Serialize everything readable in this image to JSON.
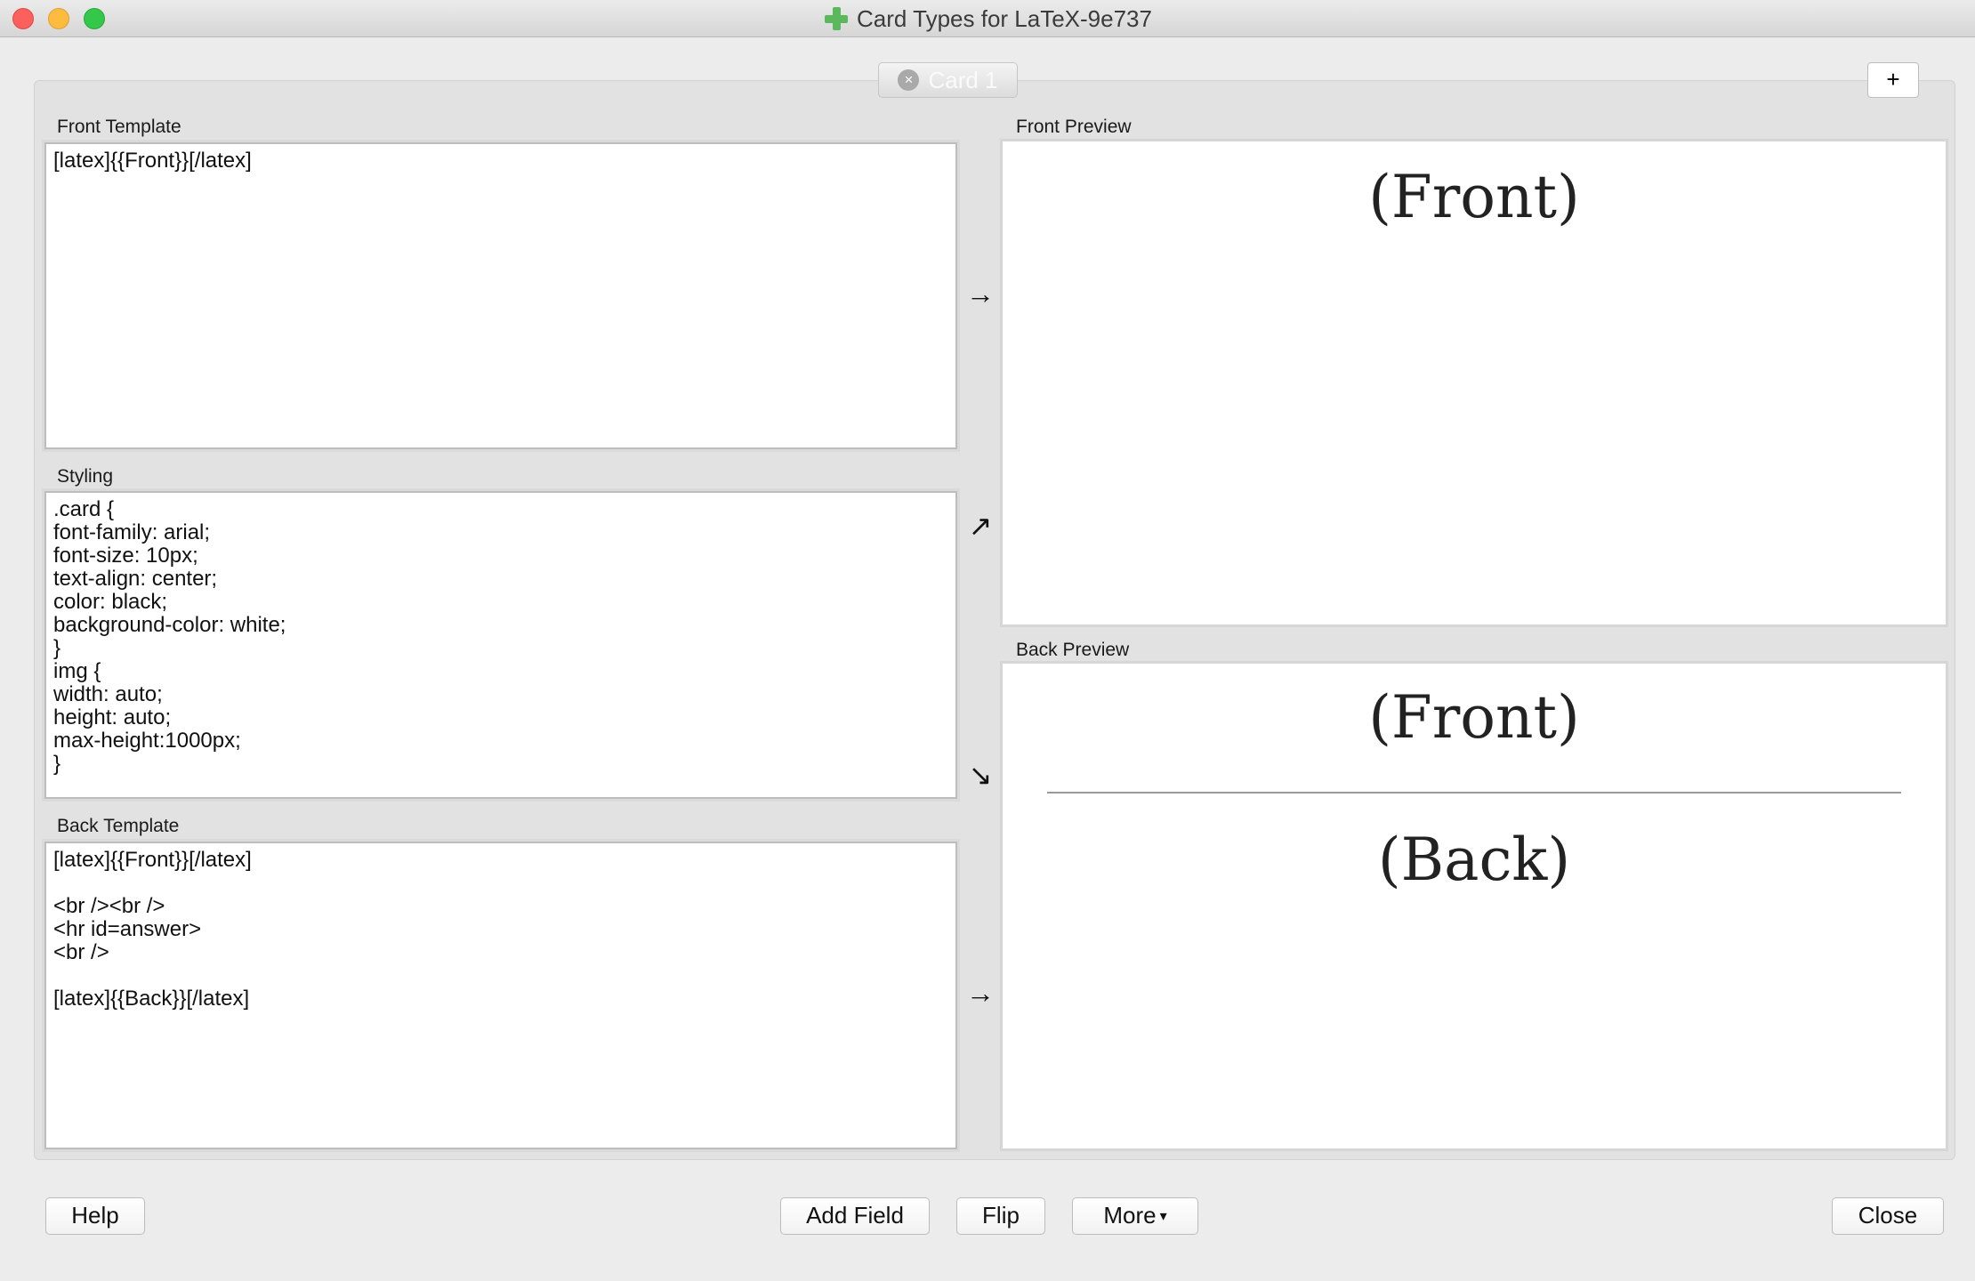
{
  "window": {
    "title": "Card Types for LaTeX-9e737"
  },
  "tabs": [
    {
      "label": "Card 1",
      "close_icon": "×"
    }
  ],
  "add_card_type_label": "+",
  "front_template": {
    "label": "Front Template",
    "content": "[latex]{{Front}}[/latex]"
  },
  "styling": {
    "label": "Styling",
    "content": ".card {\nfont-family: arial;\nfont-size: 10px;\ntext-align: center;\ncolor: black;\nbackground-color: white;\n}\nimg {\nwidth: auto;\nheight: auto;\nmax-height:1000px;\n}"
  },
  "back_template": {
    "label": "Back Template",
    "content": "[latex]{{Front}}[/latex]\n\n<br /><br />\n<hr id=answer>\n<br />\n\n[latex]{{Back}}[/latex]"
  },
  "front_preview": {
    "label": "Front Preview",
    "text": "(Front)"
  },
  "back_preview": {
    "label": "Back Preview",
    "front_text": "(Front)",
    "back_text": "(Back)"
  },
  "arrows": {
    "front": "→",
    "styling_up": "↗",
    "styling_down": "↘",
    "back": "→"
  },
  "buttons": {
    "help": "Help",
    "add_field": "Add Field",
    "flip": "Flip",
    "more": "More",
    "more_caret": "▾",
    "close": "Close"
  }
}
